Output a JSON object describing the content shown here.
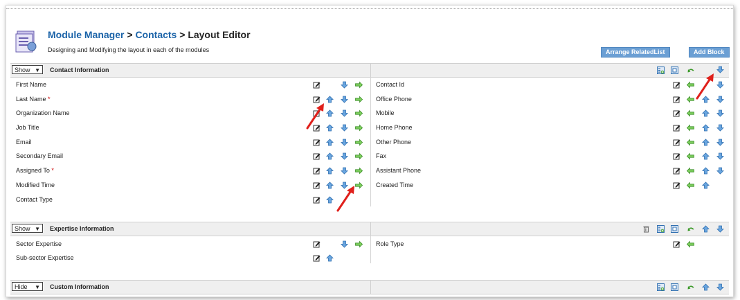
{
  "header": {
    "breadcrumb_module_manager": "Module Manager",
    "breadcrumb_sep1": " > ",
    "breadcrumb_contacts": "Contacts",
    "breadcrumb_sep2": " > ",
    "breadcrumb_current": "Layout Editor",
    "subtitle": "Designing and Modifying the layout in each of the modules",
    "arrange_button": "Arrange RelatedList",
    "add_block_button": "Add Block"
  },
  "sections": [
    {
      "visibility": "Show",
      "title": "Contact Information",
      "left_fields": [
        "First Name",
        "Last Name",
        "Organization Name",
        "Job Title",
        "Email",
        "Secondary Email",
        "Assigned To",
        "Modified Time",
        "Contact Type"
      ],
      "left_required": [
        false,
        true,
        false,
        false,
        false,
        false,
        true,
        false,
        false
      ],
      "right_fields": [
        "Contact Id",
        "Office Phone",
        "Mobile",
        "Home Phone",
        "Other Phone",
        "Fax",
        "Assistant Phone",
        "Created Time"
      ]
    },
    {
      "visibility": "Show",
      "title": "Expertise Information",
      "left_fields": [
        "Sector Expertise",
        "Sub-sector Expertise"
      ],
      "left_required": [
        false,
        false
      ],
      "right_fields": [
        "Role Type"
      ]
    },
    {
      "visibility": "Hide",
      "title": "Custom Information",
      "left_fields": [],
      "left_required": [],
      "right_fields": []
    }
  ],
  "required_marker": "*",
  "dropdown_arrow": "▼",
  "colors": {
    "link_blue": "#1b63a8",
    "button_blue": "#6b9fd4",
    "section_header_bg": "#efefef",
    "move_arrow_blue": "#5b9bd5",
    "move_arrow_green": "#4aa83a",
    "annotation_red": "#e0201b"
  },
  "icons": {
    "edit": "edit-pencil-icon",
    "move_up": "arrow-up-icon",
    "move_down": "arrow-down-icon",
    "move_right": "arrow-right-icon",
    "move_left": "arrow-left-icon",
    "add_field": "add-field-icon",
    "properties": "properties-icon",
    "undo": "undo-icon",
    "delete": "trash-icon"
  }
}
